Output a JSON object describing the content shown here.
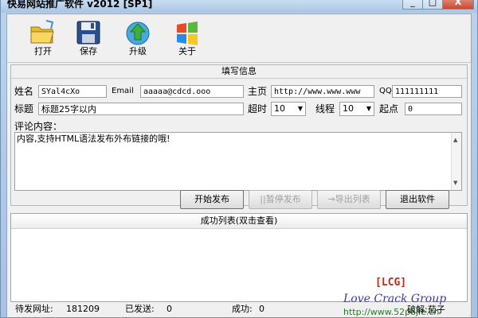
{
  "window": {
    "title": "快易网站推广软件 v2012 [SP1]",
    "controls": [
      "_",
      "□",
      "X"
    ]
  },
  "toolbar": {
    "open": "打开",
    "save": "保存",
    "upgrade": "升级",
    "about": "关于"
  },
  "form": {
    "title": "填写信息",
    "name_label": "姓名",
    "name_value": "SYal4cXo",
    "email_label": "Email",
    "email_value": "aaaaa@cdcd.ooo",
    "homepage_label": "主页",
    "homepage_value": "http://www.www.www",
    "qq_label": "QQ",
    "qq_value": "111111111",
    "subject_label": "标题",
    "subject_value": "标题25字以内",
    "timeout_label": "超时",
    "timeout_value": "10",
    "threads_label": "线程",
    "threads_value": "10",
    "start_label": "起点",
    "start_value": "0",
    "comment_label": "评论内容：",
    "comment_value": "内容,支持HTML语法发布外布链接的哦!"
  },
  "buttons": {
    "start": "开始发布",
    "pause": "||暂停发布",
    "export": "→导出列表",
    "exit": "退出软件"
  },
  "list": {
    "header": "成功列表(双击查看)"
  },
  "status": {
    "pending_label": "待发网址:",
    "pending_value": "181209",
    "sent_label": "已发送:",
    "sent_value": "0",
    "success_label": "成功:",
    "success_value": "0"
  },
  "watermark": {
    "lcg": "[LCG]",
    "group": "Love Crack Group",
    "crack": "破解:茄子",
    "url": "http://www.52pojie.cn"
  },
  "colors": {
    "title_gradient": "#a9c5e4",
    "watermark_red": "#c02818",
    "watermark_blue": "#3a3aa8"
  }
}
